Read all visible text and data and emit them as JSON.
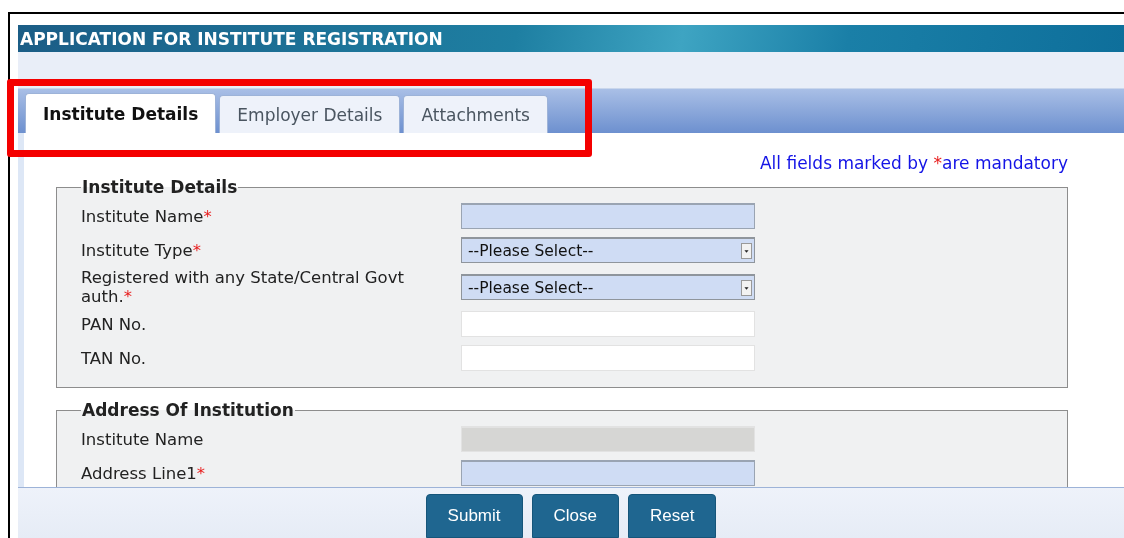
{
  "window": {
    "title": "APPLICATION FOR INSTITUTE REGISTRATION"
  },
  "tabs": [
    {
      "label": "Institute Details",
      "selected": true
    },
    {
      "label": "Employer Details",
      "selected": false
    },
    {
      "label": "Attachments",
      "selected": false
    }
  ],
  "highlight": {
    "shown": true
  },
  "mandatory_note": {
    "before": "All fields marked by ",
    "mark": "*",
    "after": "are mandatory"
  },
  "sections": [
    {
      "title": "Institute Details",
      "fields": [
        {
          "label": "Institute Name",
          "required_mark": "*",
          "kind": "text"
        },
        {
          "label": "Institute Type",
          "required_mark": "*",
          "kind": "select",
          "value": "--Please Select--"
        },
        {
          "label": "Registered with any State/Central Govt auth.",
          "required_mark": "*",
          "kind": "select",
          "value": "--Please Select--"
        },
        {
          "label": "PAN No.",
          "kind": "text"
        },
        {
          "label": "TAN No.",
          "kind": "text"
        }
      ]
    },
    {
      "title": "Address Of Institution",
      "fields": [
        {
          "label": "Institute Name",
          "kind": "text",
          "disabled": true
        },
        {
          "label": "Address Line1",
          "required_mark": "*",
          "kind": "text"
        }
      ]
    }
  ],
  "buttons": [
    "Submit",
    "Close",
    "Reset"
  ]
}
